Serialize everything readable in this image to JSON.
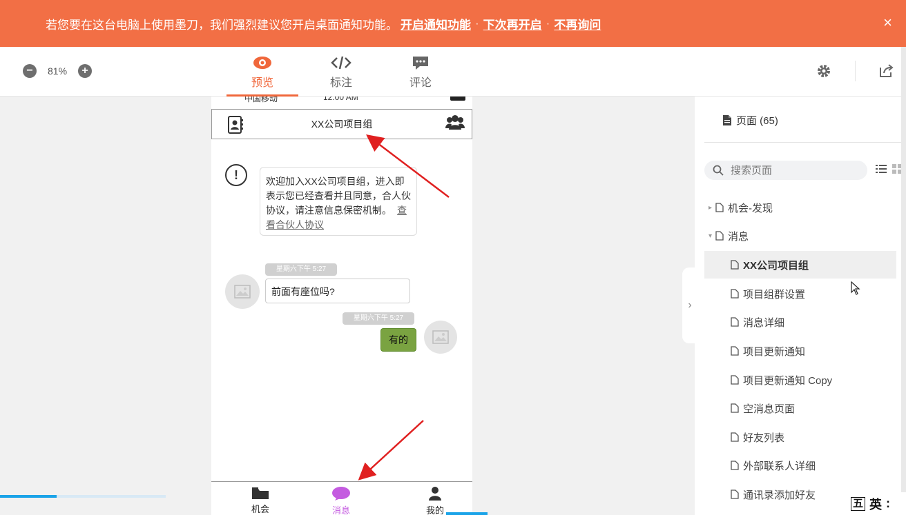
{
  "banner": {
    "message": "若您要在这台电脑上使用墨刀，我们强烈建议您开启桌面通知功能。",
    "link_enable": "开启通知功能",
    "link_later": "下次再开启",
    "link_never": "不再询问",
    "close": "×",
    "color": "#f26f45"
  },
  "toolbar": {
    "zoom_out": "−",
    "zoom_value": "81%",
    "zoom_in": "+",
    "tabs": [
      {
        "label": "预览",
        "icon": "eye-icon",
        "active": true
      },
      {
        "label": "标注",
        "icon": "code-icon",
        "active": false
      },
      {
        "label": "评论",
        "icon": "comment-icon",
        "active": false
      }
    ],
    "accent": "#f0673b"
  },
  "phone": {
    "status": {
      "carrier": "中国移动",
      "time": "12:00 AM"
    },
    "header_title": "XX公司项目组",
    "notice_text": "欢迎加入XX公司项目组，进入即表示您已经查看并且同意，合人伙协议，请注意信息保密机制。",
    "notice_link": "查看合伙人协议",
    "messages": [
      {
        "time": "星期六下午 5:27",
        "text": "前面有座位吗?",
        "side": "left"
      },
      {
        "time": "星期六下午 5:27",
        "text": "有的",
        "side": "right"
      }
    ],
    "tabbar": [
      {
        "label": "机会",
        "icon": "folder-icon"
      },
      {
        "label": "消息",
        "icon": "chat-icon",
        "active": true
      },
      {
        "label": "我的",
        "icon": "user-icon"
      }
    ]
  },
  "pages_panel": {
    "title": "页面 (65)",
    "search_placeholder": "搜索页面",
    "items": [
      {
        "label": "机会-发现",
        "level": 0,
        "caret": "▸"
      },
      {
        "label": "消息",
        "level": 0,
        "caret": "▾"
      },
      {
        "label": "XX公司项目组",
        "level": 1,
        "selected": true
      },
      {
        "label": "项目组群设置",
        "level": 1
      },
      {
        "label": "消息详细",
        "level": 1
      },
      {
        "label": "项目更新通知",
        "level": 1
      },
      {
        "label": "项目更新通知 Copy",
        "level": 1
      },
      {
        "label": "空消息页面",
        "level": 1
      },
      {
        "label": "好友列表",
        "level": 1
      },
      {
        "label": "外部联系人详细",
        "level": 1
      },
      {
        "label": "通讯录添加好友",
        "level": 1
      }
    ]
  },
  "ime": {
    "mode": "五",
    "lang": "英"
  }
}
